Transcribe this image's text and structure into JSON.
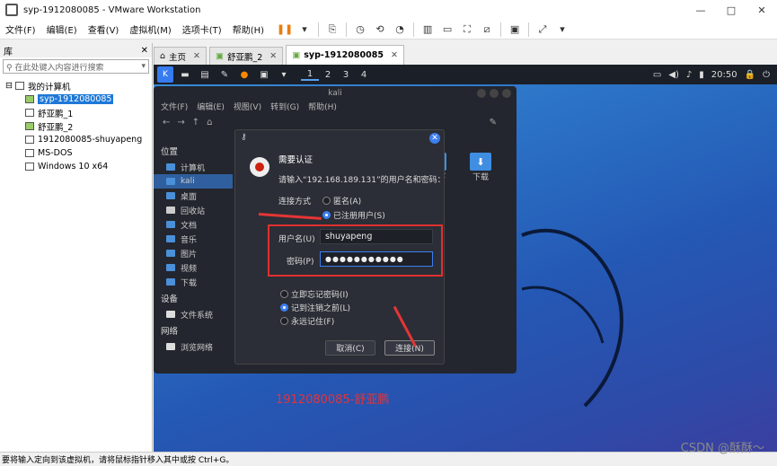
{
  "window": {
    "title": "syp-1912080085 - VMware Workstation",
    "min": "—",
    "max": "□",
    "close": "✕"
  },
  "menu": [
    "文件(F)",
    "编辑(E)",
    "查看(V)",
    "虚拟机(M)",
    "选项卡(T)",
    "帮助(H)"
  ],
  "library": {
    "title": "库",
    "close": "✕",
    "search_placeholder": "在此处键入内容进行搜索",
    "root": "我的计算机",
    "items": [
      "syp-1912080085",
      "舒亚鹏_1",
      "舒亚鹏_2",
      "1912080085-shuyapeng",
      "MS-DOS",
      "Windows 10 x64"
    ]
  },
  "tabs": [
    {
      "label": "主页"
    },
    {
      "label": "舒亚鹏_2"
    },
    {
      "label": "syp-1912080085"
    }
  ],
  "panel": {
    "workspaces": [
      "1",
      "2",
      "3",
      "4"
    ],
    "time": "20:50"
  },
  "filemanager": {
    "title": "kali",
    "menu": [
      "文件(F)",
      "编辑(E)",
      "视图(V)",
      "转到(G)",
      "帮助(H)"
    ],
    "sections": {
      "places": "位置",
      "devices": "设备",
      "network": "网络"
    },
    "places": [
      "计算机",
      "kali",
      "桌面",
      "回收站",
      "文档",
      "音乐",
      "图片",
      "视频",
      "下载"
    ],
    "devices": [
      "文件系统"
    ],
    "network": [
      "浏览网络"
    ],
    "folder_label": "下载",
    "partial_folder_label": "下"
  },
  "dialog": {
    "title": "需要认证",
    "message": "请输入“192.168.189.131”的用户名和密码：",
    "connect_as_label": "连接方式",
    "anon_label": "匿名(A)",
    "registered_label": "已注册用户(S)",
    "username_label": "用户名(U)",
    "username_value": "shuyapeng",
    "password_label": "密码(P)",
    "password_value": "●●●●●●●●●●●",
    "remember": [
      "立即忘记密码(I)",
      "记到注销之前(L)",
      "永远记住(F)"
    ],
    "cancel": "取消(C)",
    "connect": "连接(N)"
  },
  "watermark": "1912080085-舒亚鹏",
  "status": "要将输入定向到该虚拟机，请将鼠标指针移入其中或按 Ctrl+G。",
  "csdn": "CSDN @酥酥～"
}
